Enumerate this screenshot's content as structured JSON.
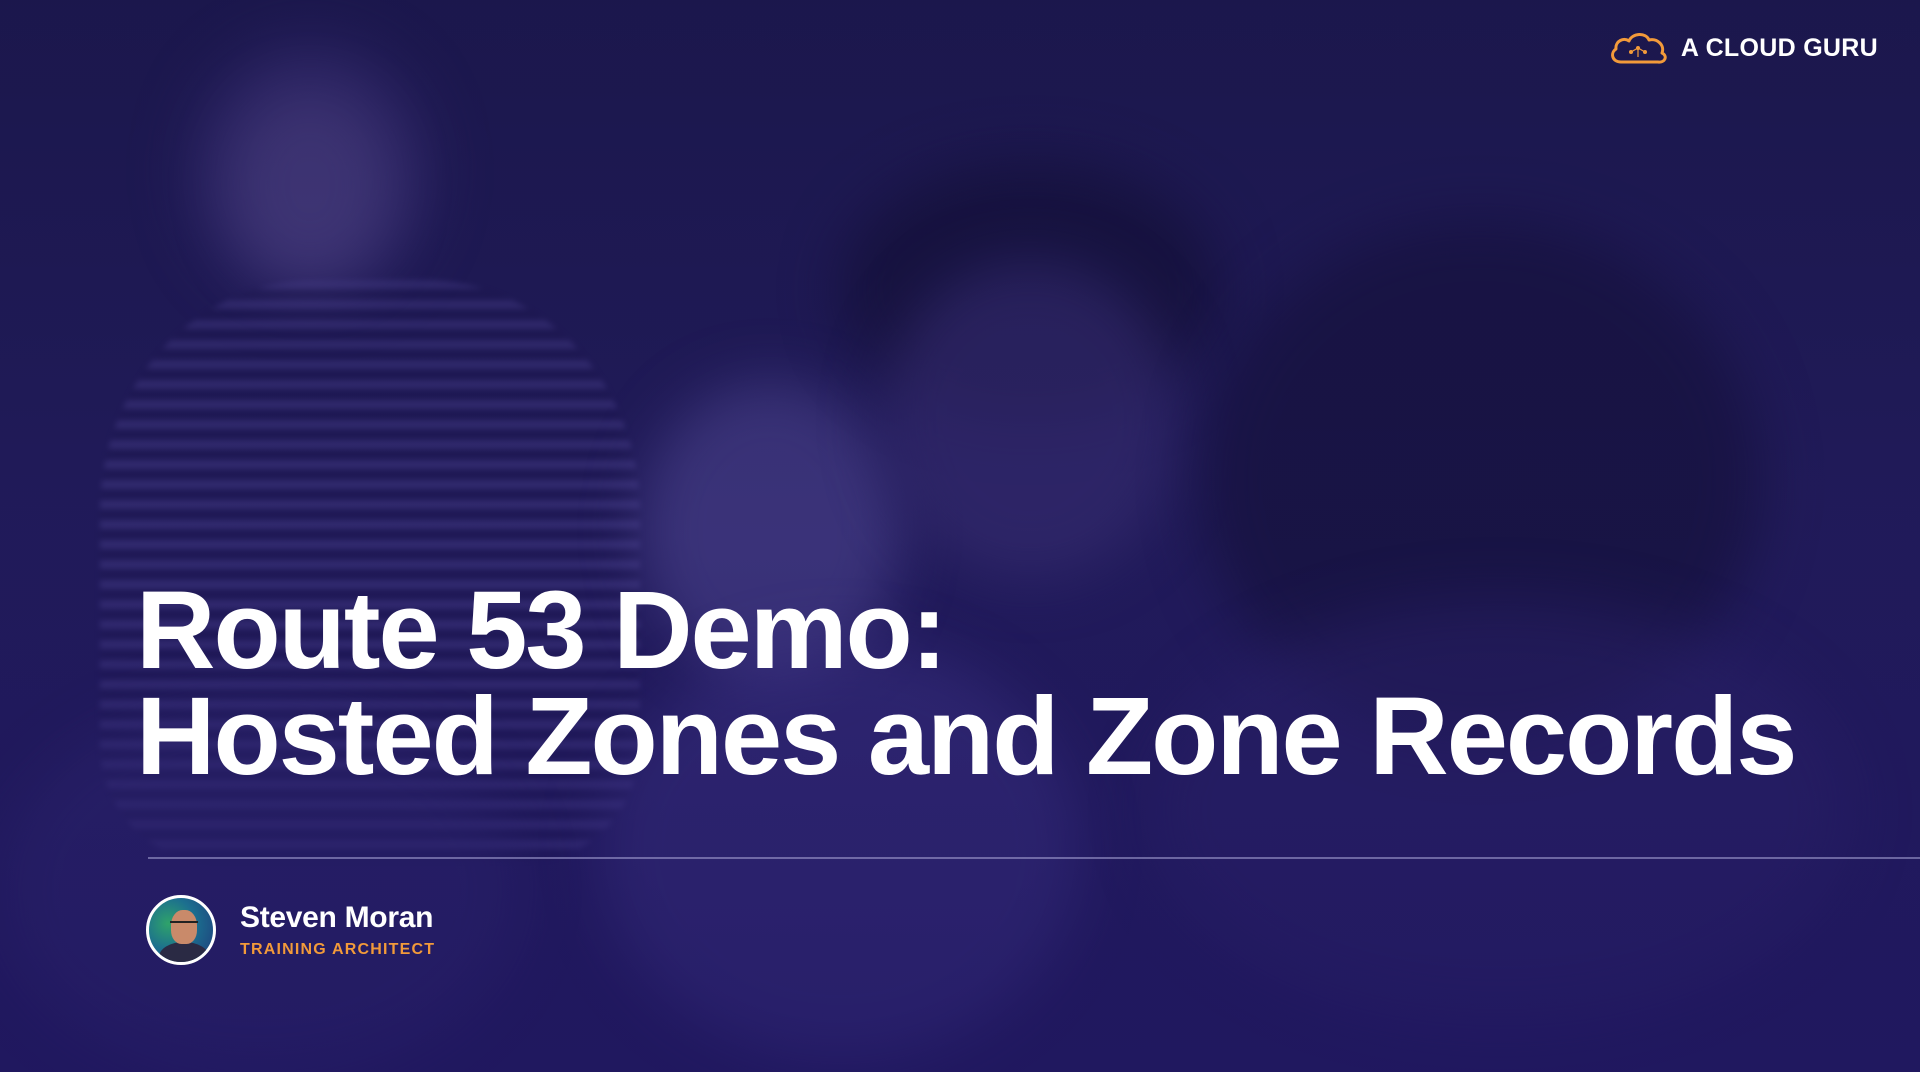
{
  "brand": {
    "logo_text": "A CLOUD GURU",
    "logo_icon": "cloud-logo-icon",
    "accent_color": "#f29a3a"
  },
  "slide": {
    "title_line_1": "Route 53 Demo:",
    "title_line_2": "Hosted Zones and Zone Records",
    "background_color": "#1f1a58"
  },
  "presenter": {
    "name": "Steven Moran",
    "role": "TRAINING ARCHITECT",
    "avatar_icon": "presenter-avatar"
  }
}
